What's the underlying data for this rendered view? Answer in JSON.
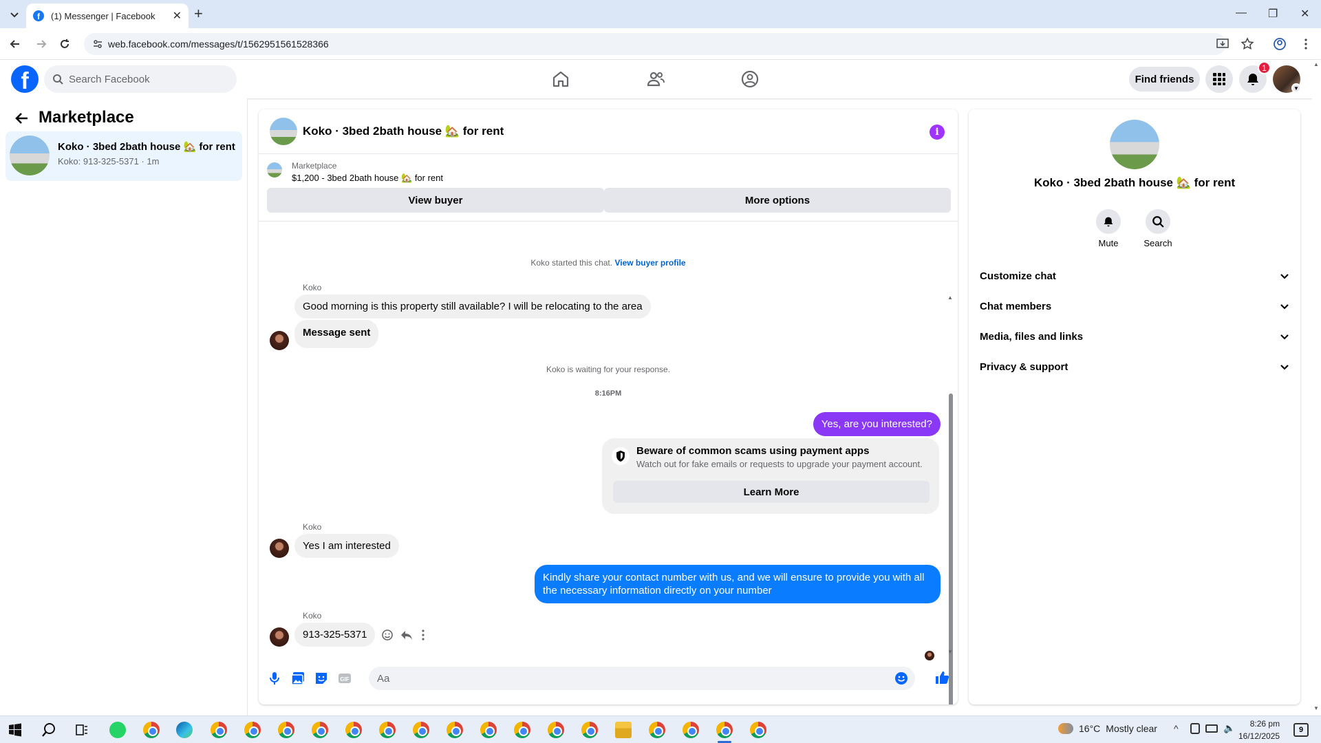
{
  "browser": {
    "tab_title": "(1) Messenger | Facebook",
    "url": "web.facebook.com/messages/t/1562951561528366"
  },
  "header": {
    "search_placeholder": "Search Facebook",
    "find_friends": "Find friends",
    "notification_count": "1"
  },
  "sidebar": {
    "title": "Marketplace",
    "conversation": {
      "name": "Koko · 3bed 2bath house 🏡 for rent",
      "preview": "Koko: 913-325-5371 · 1m"
    }
  },
  "chat": {
    "title": "Koko · 3bed 2bath house 🏡 for rent",
    "listing_label": "Marketplace",
    "listing_price": "$1,200 - 3bed 2bath house 🏡 for rent",
    "view_buyer": "View buyer",
    "more_options": "More options",
    "started_text": "Koko started this chat.",
    "view_buyer_profile": "View buyer profile",
    "sender_name": "Koko",
    "msg1": "Good morning is this property still available? I will be relocating to the area",
    "msg2": "Message sent",
    "waiting_text": "Koko is waiting for your response.",
    "time": "8:16PM",
    "msg3": "Yes, are you interested?",
    "warning_title": "Beware of common scams using payment apps",
    "warning_text": "Watch out for fake emails or requests to upgrade your payment account.",
    "learn_more": "Learn More",
    "msg4": "Yes I am interested",
    "msg5": "Kindly share your contact number with us, and we will ensure to provide you with all the necessary information directly on your number",
    "msg6": "913-325-5371",
    "composer_placeholder": "Aa"
  },
  "details": {
    "name": "Koko · 3bed 2bath house 🏡 for rent",
    "mute": "Mute",
    "search": "Search",
    "rows": [
      "Customize chat",
      "Chat members",
      "Media, files and links",
      "Privacy & support"
    ]
  },
  "taskbar": {
    "temperature": "16°C",
    "weather": "Mostly clear",
    "time": "8:26 pm",
    "date": "16/12/2025",
    "notifications": "9"
  },
  "colors": {
    "brand": "#0866ff",
    "outgoing_bubble_1": "#8a38f5",
    "outgoing_bubble_2": "#0a7cff",
    "info_accent": "#a033ff"
  }
}
